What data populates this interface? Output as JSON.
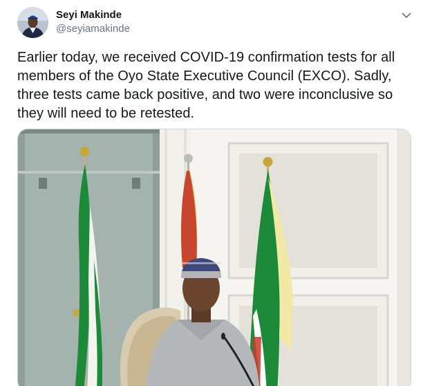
{
  "author": {
    "name": "Seyi Makinde",
    "handle": "@seyiamakinde"
  },
  "tweet": {
    "text": "Earlier today, we received COVID-19 confirmation tests for all\nmembers of the Oyo State Executive Council (EXCO). Sadly,\nthree tests came back positive, and two were inconclusive so\nthey will need to be retested."
  },
  "icons": {
    "more": "chevron-down-icon"
  },
  "colors": {
    "text": "#14171a",
    "secondary": "#657786",
    "border": "#ccd6dd"
  }
}
